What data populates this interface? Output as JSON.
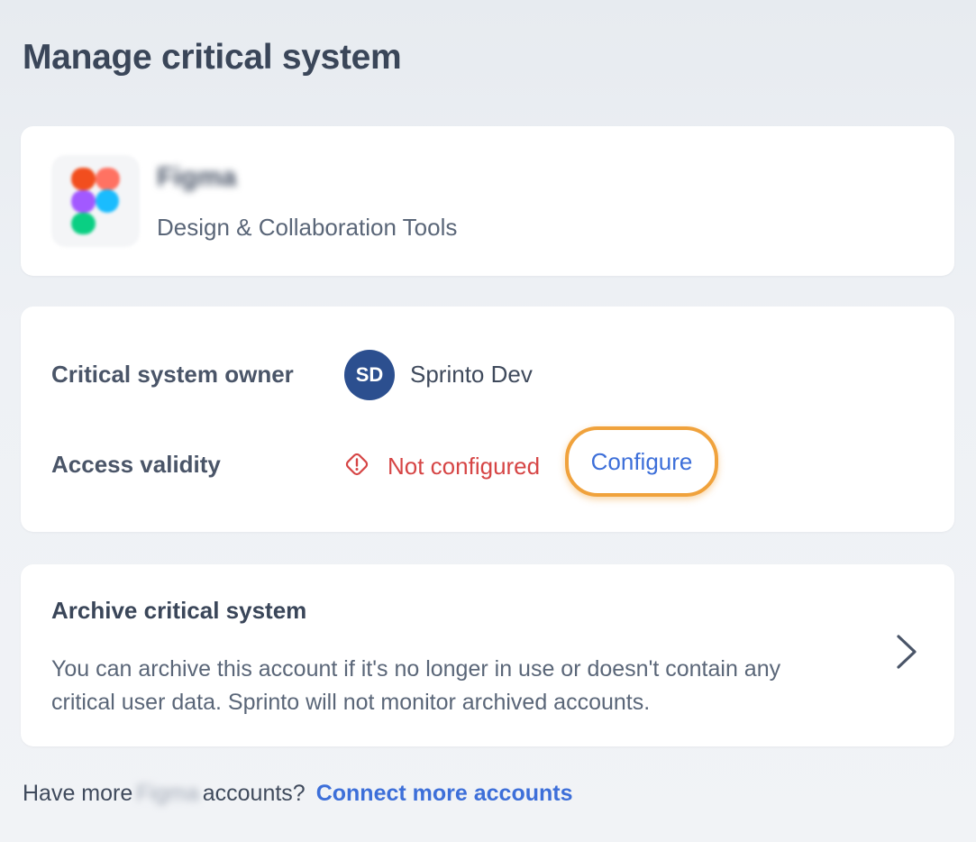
{
  "page": {
    "title": "Manage critical system"
  },
  "app": {
    "name": "Figma",
    "category": "Design & Collaboration Tools",
    "logo_icon": "figma-logo-icon"
  },
  "details": {
    "owner_label": "Critical system owner",
    "owner_initials": "SD",
    "owner_name": "Sprinto Dev",
    "owner_avatar_color": "#2c4f8f",
    "validity_label": "Access validity",
    "validity_status": "Not configured",
    "validity_status_icon": "warning-diamond-icon",
    "validity_status_color": "#d64545",
    "configure_label": "Configure",
    "highlight_color": "#f0a23c"
  },
  "archive": {
    "title": "Archive critical system",
    "description": "You can archive this account if it's no longer in use or doesn't contain any critical user data. Sprinto will not monitor archived accounts.",
    "chevron_icon": "chevron-right-icon"
  },
  "footer": {
    "prefix": "Have more",
    "app_name": "Figma",
    "suffix": "accounts?",
    "link_label": "Connect more accounts",
    "link_color": "#3d6fd9"
  }
}
